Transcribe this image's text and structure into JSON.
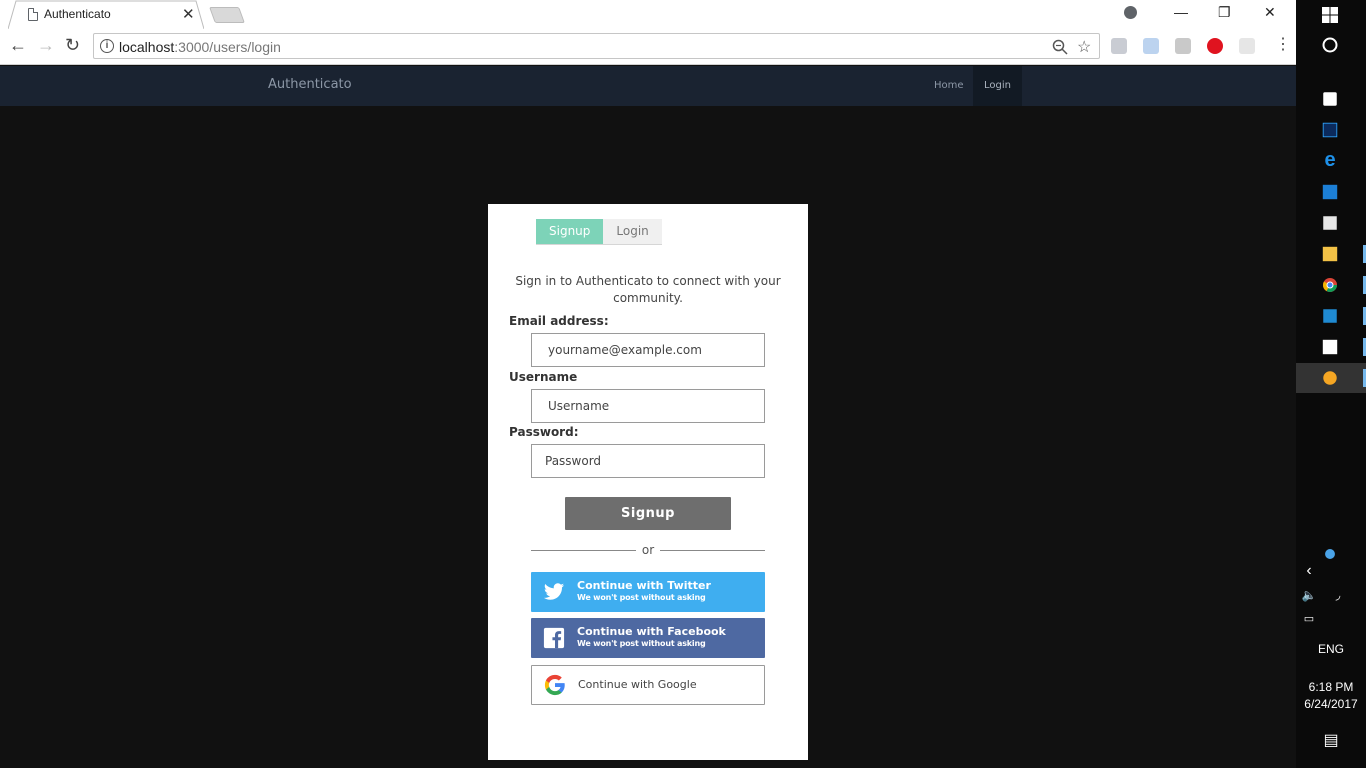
{
  "browser": {
    "tab_title": "Authenticato",
    "tab_close": "✕",
    "url_host": "localhost",
    "url_path": ":3000/users/login",
    "window_controls": {
      "minimize": "—",
      "restore": "❐",
      "close": "✕"
    }
  },
  "site": {
    "brand": "Authenticato",
    "nav": {
      "home": "Home",
      "login": "Login"
    }
  },
  "form": {
    "tabs": {
      "signup": "Signup",
      "login": "Login"
    },
    "intro": "Sign in to Authenticato to connect with your community.",
    "email_label": "Email address:",
    "email_placeholder": "yourname@example.com",
    "username_label": "Username",
    "username_placeholder": "Username",
    "password_label": "Password:",
    "password_placeholder": "Password",
    "submit": "Signup",
    "or": "or",
    "twitter_title": "Continue with Twitter",
    "twitter_sub": "We won't post without asking",
    "facebook_title": "Continue with Facebook",
    "facebook_sub": "We won't post without asking",
    "google_title": "Continue with Google"
  },
  "taskbar": {
    "language": "ENG",
    "time": "6:18 PM",
    "date": "6/24/2017"
  },
  "colors": {
    "navbar": "#1a2331",
    "signup_tab": "#7dd3b8",
    "twitter": "#3faef0",
    "facebook": "#4e69a2",
    "submit": "#6e6e6e"
  }
}
